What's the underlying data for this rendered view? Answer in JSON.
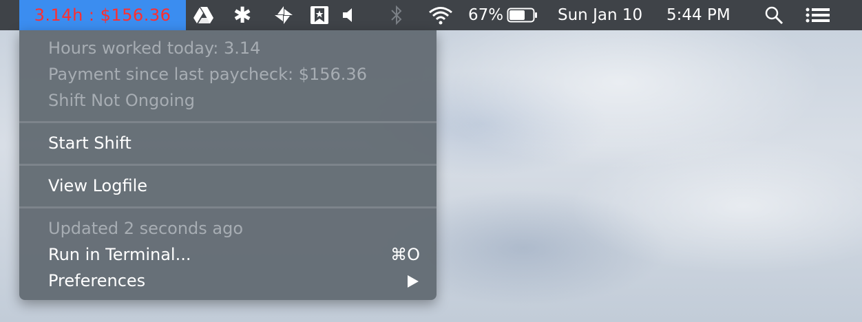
{
  "menubar": {
    "status_item": "3.14h : $156.36",
    "icons": [
      "google-drive-icon",
      "asterisk-icon",
      "pinwheel-icon",
      "bookmark-star-icon",
      "volume-icon",
      "bluetooth-icon",
      "wifi-icon"
    ],
    "battery_percent": "67%",
    "battery_level": 0.67,
    "date": "Sun Jan 10",
    "time": "5:44 PM"
  },
  "menu": {
    "info": {
      "hours": "Hours worked today: 3.14",
      "payment": "Payment since last paycheck: $156.36",
      "shift_status": "Shift Not Ongoing"
    },
    "start_shift": "Start Shift",
    "view_logfile": "View Logfile",
    "updated": "Updated 2 seconds ago",
    "run_in_terminal": "Run in Terminal...",
    "run_shortcut": "⌘O",
    "preferences": "Preferences"
  },
  "colors": {
    "status_highlight": "#3b8df0",
    "status_text": "#ff2e2e",
    "menubar_bg": "#3f4348",
    "menu_bg": "#606870"
  }
}
